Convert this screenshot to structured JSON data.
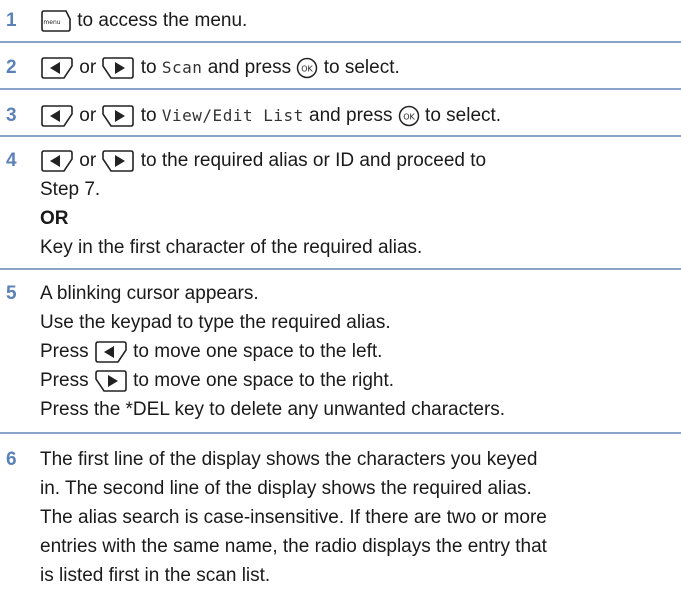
{
  "steps": [
    {
      "number": "1",
      "text": "to access the menu.",
      "key_label": "menu"
    },
    {
      "number": "2",
      "pre": "or",
      "mid": "to",
      "menu_item": "Scan",
      "post": "and press",
      "end": "to select."
    },
    {
      "number": "3",
      "pre": "or",
      "mid": "to",
      "menu_item": "View/Edit List",
      "post": "and press",
      "end": "to select."
    },
    {
      "number": "4",
      "pre": "or",
      "line1": "to the required alias or ID and proceed to",
      "line2": "Step 7.",
      "or_label": "OR",
      "line4": "Key in the first character of the required alias."
    },
    {
      "number": "5",
      "lines": [
        "A blinking cursor appears.",
        "Use the keypad to type the required alias."
      ],
      "press": "Press",
      "left_text": "to move one space to the left.",
      "right_text": "to move one space to the right.",
      "last": "Press the *DEL key to delete any unwanted characters."
    },
    {
      "number": "6",
      "lines": [
        "The first line of the display shows the characters you keyed",
        "in. The second line of the display shows the required alias.",
        "The alias search is case-insensitive. If there are two or more",
        "entries with the same name, the radio displays the entry that",
        "is listed first in the scan list."
      ]
    }
  ],
  "key_labels": {
    "ok": "OK"
  },
  "colors": {
    "step_number": "#5b82b8",
    "rule": "#8aa4c8"
  }
}
